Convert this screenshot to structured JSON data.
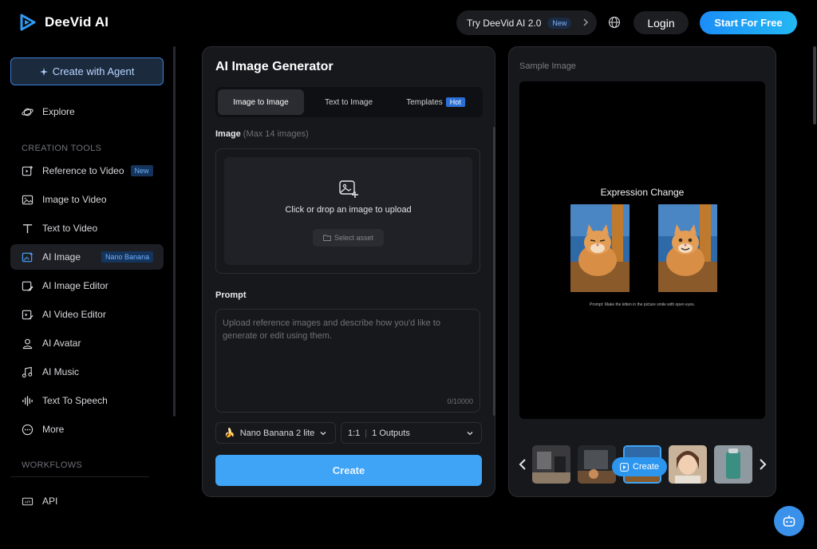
{
  "header": {
    "brand": "DeeVid AI",
    "try_label": "Try DeeVid AI 2.0",
    "try_badge": "New",
    "login": "Login",
    "start": "Start For Free"
  },
  "sidebar": {
    "agent_button": "Create with Agent",
    "explore": "Explore",
    "section_creation": "CREATION TOOLS",
    "items": [
      {
        "label": "Reference to Video",
        "badge": "New",
        "icon": "reference-video-icon"
      },
      {
        "label": "Image to Video",
        "icon": "image-icon"
      },
      {
        "label": "Text to Video",
        "icon": "text-icon"
      },
      {
        "label": "AI Image",
        "badge": "Nano Banana",
        "icon": "ai-image-icon"
      },
      {
        "label": "AI Image Editor",
        "icon": "image-editor-icon"
      },
      {
        "label": "AI Video Editor",
        "icon": "video-editor-icon"
      },
      {
        "label": "AI Avatar",
        "icon": "avatar-icon"
      },
      {
        "label": "AI Music",
        "icon": "music-icon"
      },
      {
        "label": "Text To Speech",
        "icon": "waveform-icon"
      },
      {
        "label": "More",
        "icon": "more-icon"
      }
    ],
    "section_workflows": "WORKFLOWS",
    "api": "API"
  },
  "generator": {
    "title": "AI Image Generator",
    "tabs": [
      {
        "label": "Image to Image"
      },
      {
        "label": "Text to Image"
      },
      {
        "label": "Templates",
        "badge": "Hot"
      }
    ],
    "image_label": "Image",
    "image_hint": "(Max 14 images)",
    "upload_text": "Click or drop an image to upload",
    "select_asset": "Select asset",
    "prompt_label": "Prompt",
    "prompt_placeholder": "Upload reference images and describe how you'd like to generate or edit using them.",
    "prompt_counter": "0/10000",
    "model": "Nano Banana 2 lite",
    "ratio": "1:1",
    "outputs": "1 Outputs",
    "create": "Create"
  },
  "sample": {
    "label": "Sample Image",
    "heading": "Expression Change",
    "caption": "Prompt: Make the kitten in the picture smile with open eyes.",
    "create_pill": "Create"
  },
  "colors": {
    "accent": "#3fa4f5",
    "brand_gradient_start": "#1b8df7",
    "brand_gradient_end": "#23b8f3",
    "panel_bg": "#17181c"
  }
}
